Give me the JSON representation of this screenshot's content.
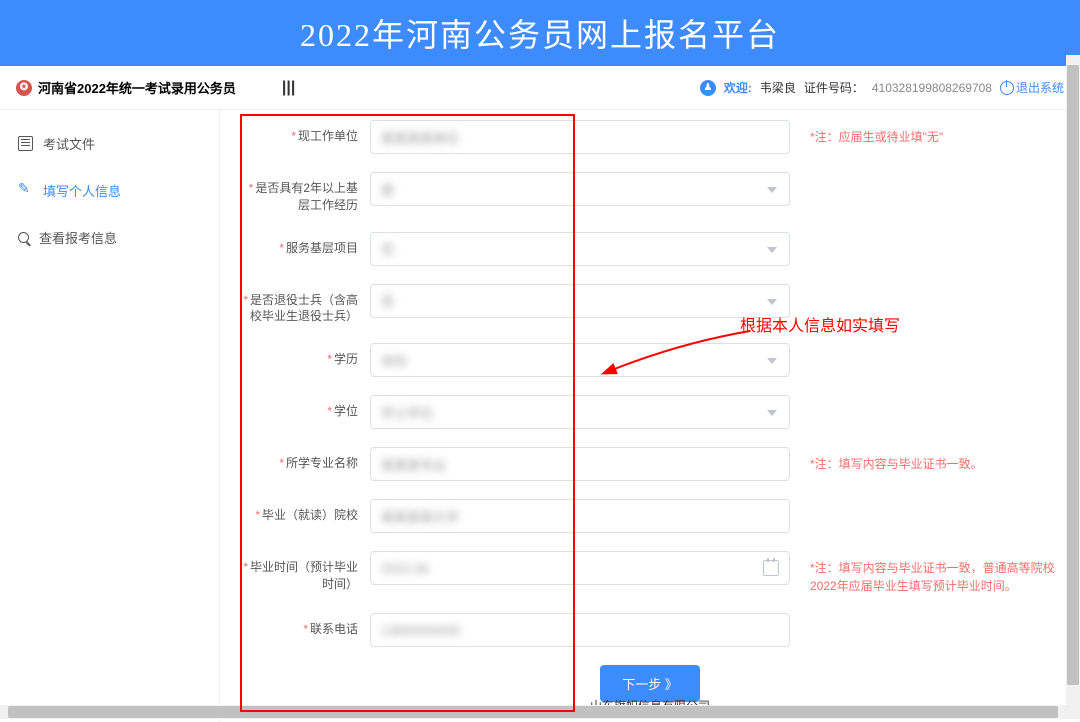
{
  "banner": "2022年河南公务员网上报名平台",
  "topbar": {
    "exam_title": "河南省2022年统一考试录用公务员",
    "welcome_label": "欢迎:",
    "user_name": "韦梁良",
    "id_label": "证件号码：",
    "id_number": "410328199808269708",
    "logout": "退出系统"
  },
  "sidebar": {
    "items": [
      {
        "label": "考试文件"
      },
      {
        "label": "填写个人信息"
      },
      {
        "label": "查看报考信息"
      }
    ]
  },
  "form": {
    "fields": [
      {
        "label": "现工作单位",
        "type": "text",
        "value": "某某某某单位",
        "note": "*注：应届生或待业填\"无\""
      },
      {
        "label": "是否具有2年以上基层工作经历",
        "type": "select",
        "value": "是",
        "note": ""
      },
      {
        "label": "服务基层项目",
        "type": "select",
        "value": "无",
        "note": ""
      },
      {
        "label": "是否退役士兵（含高校毕业生退役士兵）",
        "type": "select",
        "value": "否",
        "note": ""
      },
      {
        "label": "学历",
        "type": "select",
        "value": "本科",
        "note": ""
      },
      {
        "label": "学位",
        "type": "select",
        "value": "学士学位",
        "note": ""
      },
      {
        "label": "所学专业名称",
        "type": "text",
        "value": "某某某专业",
        "note": "*注：填写内容与毕业证书一致。"
      },
      {
        "label": "毕业（就读）院校",
        "type": "text",
        "value": "某某某某大学",
        "note": ""
      },
      {
        "label": "毕业时间（预计毕业时间）",
        "type": "date",
        "value": "2022-06",
        "note": "*注：填写内容与毕业证书一致，普通高等院校2022年应届毕业生填写预计毕业时间。"
      },
      {
        "label": "联系电话",
        "type": "text",
        "value": "13800000000",
        "note": ""
      }
    ],
    "next_button": "下一步 》"
  },
  "annotation": "根据本人信息如实填写",
  "footer": "山东旗帜信息有限公司"
}
